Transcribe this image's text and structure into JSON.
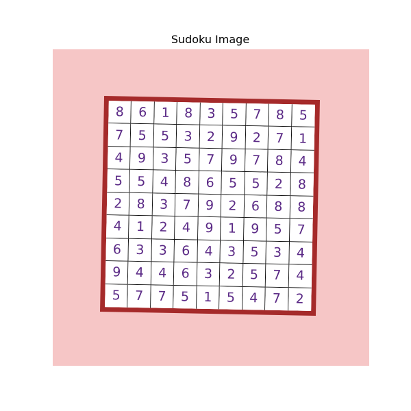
{
  "title": "Sudoku Image",
  "colors": {
    "background": "#f6c6c6",
    "frame": "#a52a2a",
    "digit": "#5b2a86",
    "gridline": "#111111"
  },
  "board": [
    [
      "8",
      "6",
      "1",
      "8",
      "3",
      "5",
      "7",
      "8",
      "5"
    ],
    [
      "7",
      "5",
      "5",
      "3",
      "2",
      "9",
      "2",
      "7",
      "1"
    ],
    [
      "4",
      "9",
      "3",
      "5",
      "7",
      "9",
      "7",
      "8",
      "4"
    ],
    [
      "5",
      "5",
      "4",
      "8",
      "6",
      "5",
      "5",
      "2",
      "8"
    ],
    [
      "2",
      "8",
      "3",
      "7",
      "9",
      "2",
      "6",
      "8",
      "8"
    ],
    [
      "4",
      "1",
      "2",
      "4",
      "9",
      "1",
      "9",
      "5",
      "7"
    ],
    [
      "6",
      "3",
      "3",
      "6",
      "4",
      "3",
      "5",
      "3",
      "4"
    ],
    [
      "9",
      "4",
      "4",
      "6",
      "3",
      "2",
      "5",
      "7",
      "4"
    ],
    [
      "5",
      "7",
      "7",
      "5",
      "1",
      "5",
      "4",
      "7",
      "2"
    ]
  ]
}
